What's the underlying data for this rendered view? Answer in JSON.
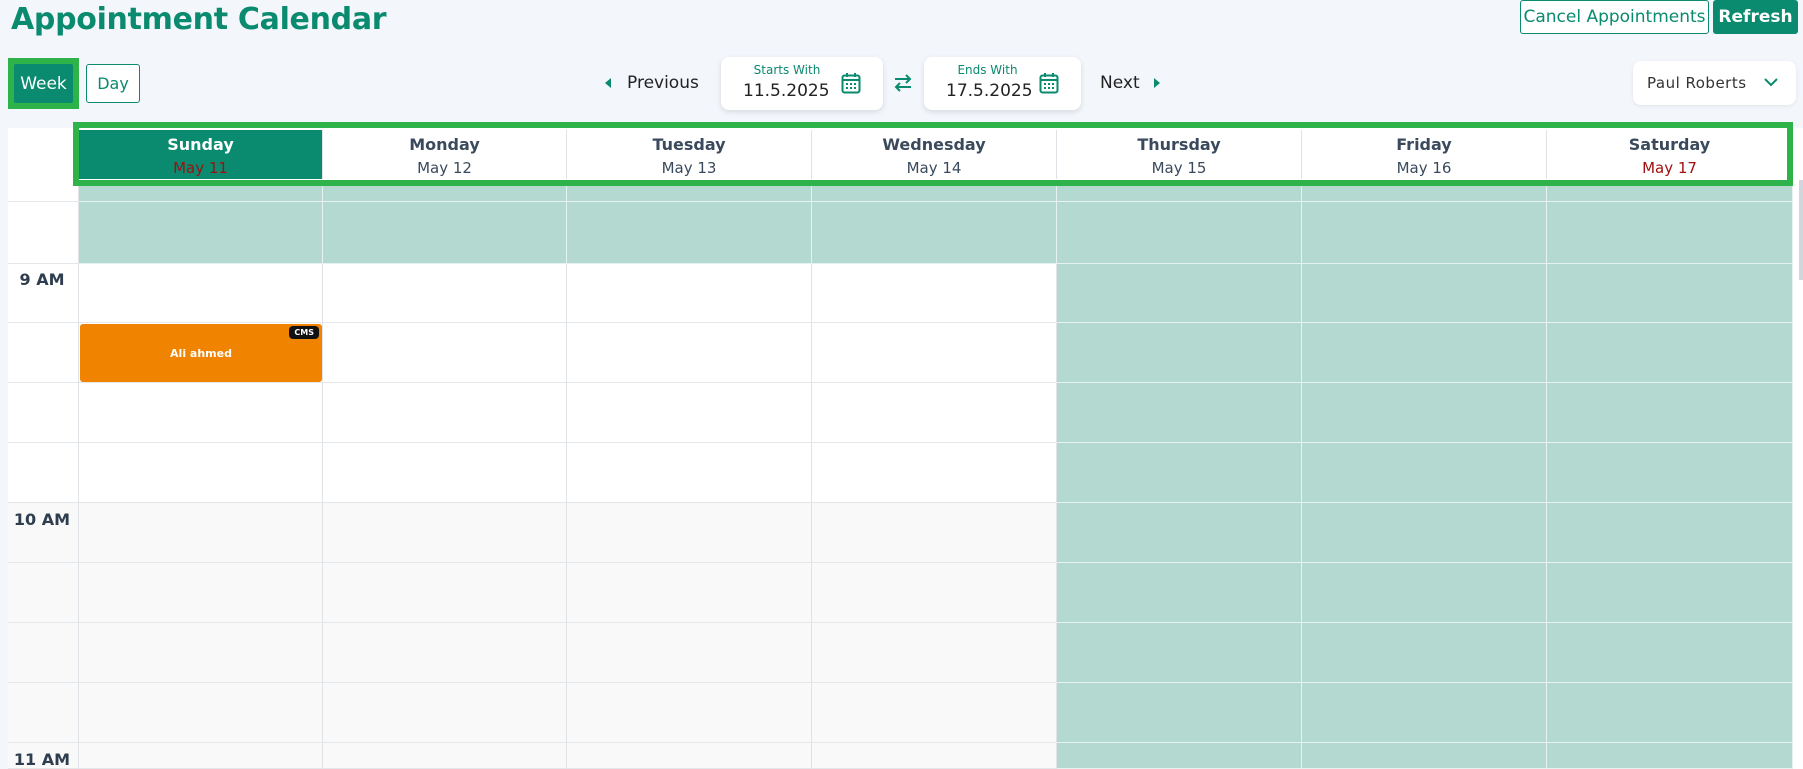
{
  "header": {
    "title": "Appointment Calendar",
    "cancel_label": "Cancel Appointments",
    "refresh_label": "Refresh"
  },
  "view_toggle": {
    "week_label": "Week",
    "day_label": "Day",
    "active": "Week"
  },
  "navigation": {
    "previous_label": "Previous",
    "next_label": "Next",
    "start": {
      "label": "Starts With",
      "value": "11.5.2025"
    },
    "end": {
      "label": "Ends With",
      "value": "17.5.2025"
    }
  },
  "user_select": {
    "value": "Paul Roberts"
  },
  "days": [
    {
      "name": "Sunday",
      "date": "May 11",
      "active": true,
      "weekend": true
    },
    {
      "name": "Monday",
      "date": "May 12",
      "active": false,
      "weekend": false
    },
    {
      "name": "Tuesday",
      "date": "May 13",
      "active": false,
      "weekend": false
    },
    {
      "name": "Wednesday",
      "date": "May 14",
      "active": false,
      "weekend": false
    },
    {
      "name": "Thursday",
      "date": "May 15",
      "active": false,
      "weekend": false
    },
    {
      "name": "Friday",
      "date": "May 16",
      "active": false,
      "weekend": false
    },
    {
      "name": "Saturday",
      "date": "May 17",
      "active": false,
      "weekend": true
    }
  ],
  "time_labels": [
    "9 AM",
    "10 AM",
    "11 AM"
  ],
  "appointments": [
    {
      "name": "Ali ahmed",
      "badge": "CMS",
      "day": "Sunday"
    }
  ],
  "colors": {
    "brand": "#0a8a6f",
    "highlight": "#2db34a",
    "unavailable": "#b3d9d1",
    "appointment": "#f08300",
    "weekend_date": "#a01010"
  }
}
